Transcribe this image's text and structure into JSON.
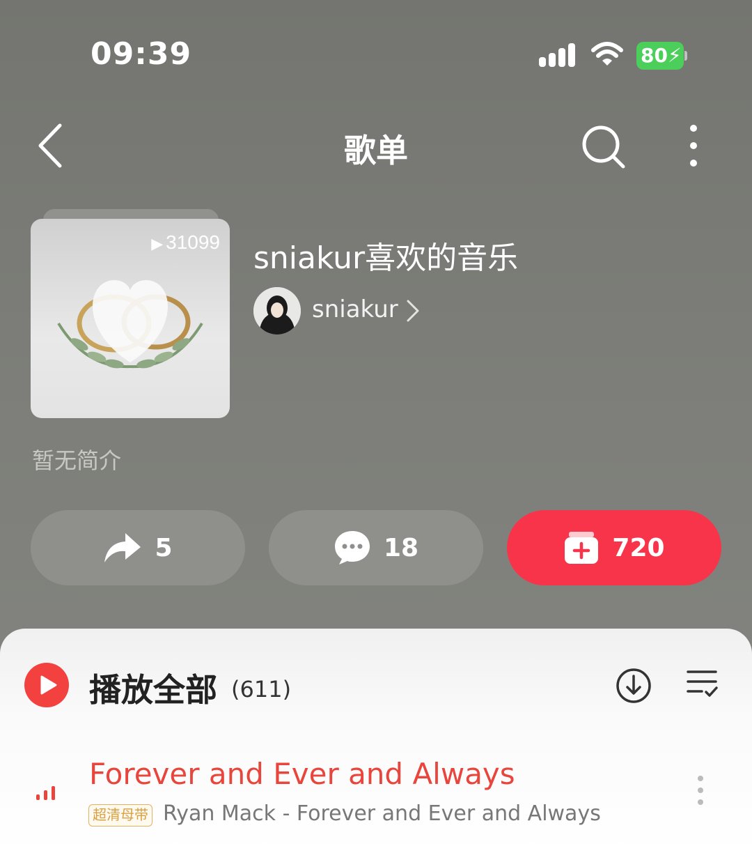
{
  "status_bar": {
    "time": "09:39",
    "battery": "80"
  },
  "nav": {
    "title": "歌单"
  },
  "playlist": {
    "play_count": "31099",
    "title": "sniakur喜欢的音乐",
    "creator": "sniakur",
    "description": "暂无简介"
  },
  "actions": {
    "share_count": "5",
    "comment_count": "18",
    "collect_count": "720"
  },
  "list_header": {
    "play_all_label": "播放全部",
    "count": "(611)"
  },
  "songs": [
    {
      "title": "Forever and Ever and Always",
      "quality_badge": "超清母带",
      "subtitle": "Ryan Mack - Forever and Ever and Always"
    }
  ],
  "colors": {
    "accent_red": "#f8344a",
    "song_playing": "#e8453c",
    "battery_green": "#4bcf5a"
  }
}
